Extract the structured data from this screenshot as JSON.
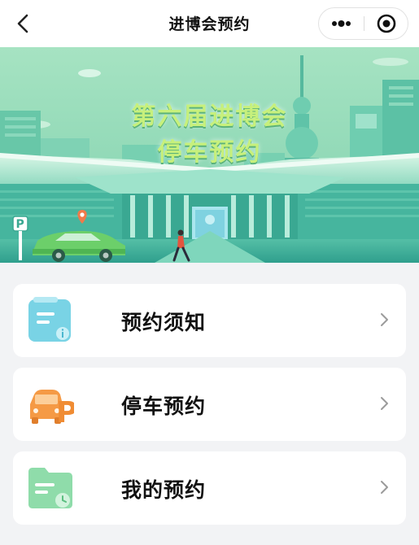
{
  "header": {
    "title": "进博会预约",
    "back_icon": "chevron-left-icon",
    "more_icon": "more-dots-icon",
    "close_icon": "target-close-icon"
  },
  "banner": {
    "title_line1": "第六届进博会",
    "title_line2": "停车预约",
    "colors": {
      "sky": "#86d6b3",
      "building": "#3fb8a5",
      "text": "#c7f07c",
      "car": "#6ccf6a"
    }
  },
  "menu": {
    "items": [
      {
        "label": "预约须知",
        "icon": "notice-clipboard-icon",
        "color": "#79d3e5"
      },
      {
        "label": "停车预约",
        "icon": "parking-car-icon",
        "color": "#f59a45"
      },
      {
        "label": "我的预约",
        "icon": "my-booking-folder-icon",
        "color": "#8fdcaa"
      }
    ]
  },
  "colors": {
    "background": "#f2f3f5",
    "card": "#ffffff",
    "text": "#111111",
    "chevron": "#9b9b9b"
  }
}
